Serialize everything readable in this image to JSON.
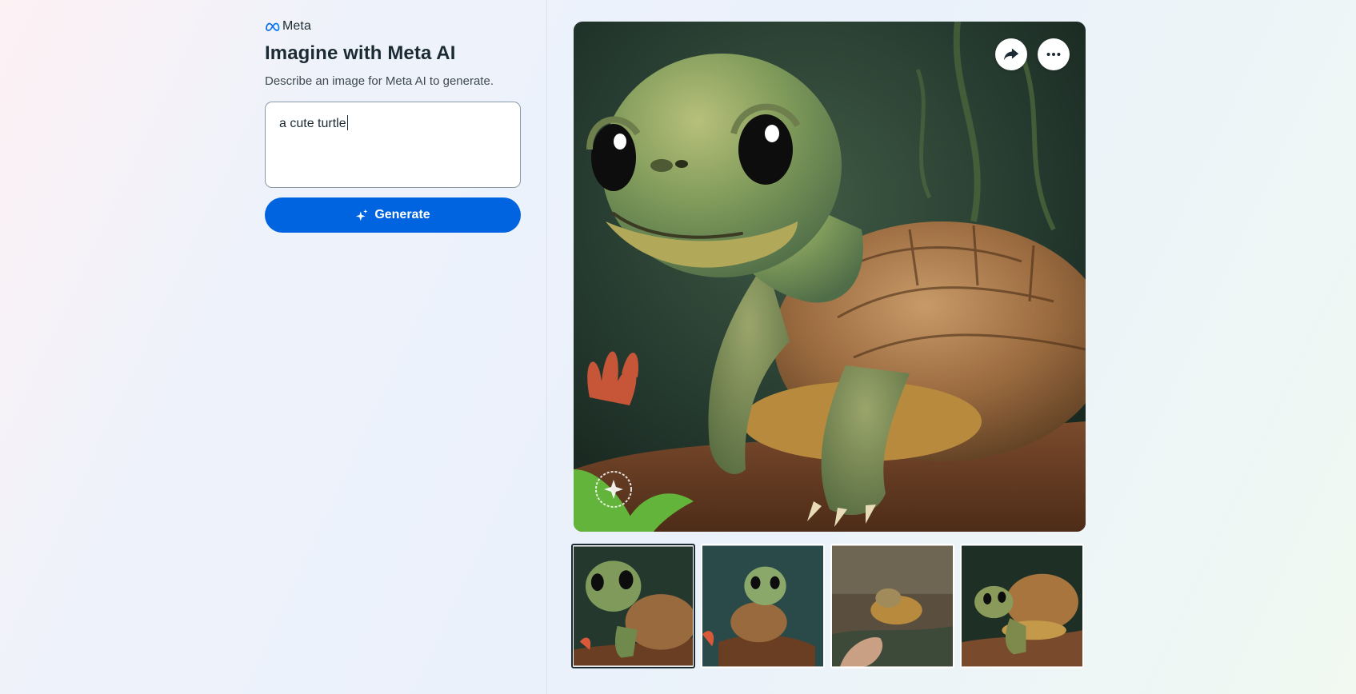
{
  "brand": {
    "name": "Meta",
    "logo_icon": "meta-infinity-icon"
  },
  "page": {
    "title": "Imagine with Meta AI",
    "subtitle": "Describe an image for Meta AI to generate."
  },
  "prompt": {
    "value": "a cute turtle"
  },
  "generate": {
    "label": "Generate",
    "icon": "sparkle-icon"
  },
  "image_actions": {
    "share_icon": "share-arrow-icon",
    "more_icon": "more-horizontal-icon"
  },
  "thumbnails": {
    "count": 4,
    "selected_index": 0
  },
  "colors": {
    "accent": "#0064e0",
    "text": "#1c2b33"
  }
}
